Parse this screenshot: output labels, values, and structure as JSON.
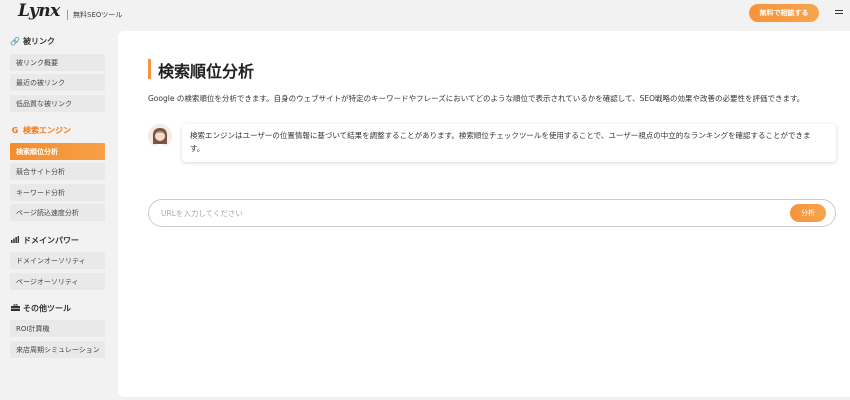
{
  "header": {
    "logo_text": "Lynx",
    "logo_sub": "無料SEOツール",
    "cta_label": "無料で相談する"
  },
  "sidebar": {
    "sections": [
      {
        "title": "被リンク",
        "icon": "link-icon",
        "items": [
          "被リンク概要",
          "最近の被リンク",
          "低品質な被リンク"
        ]
      },
      {
        "title": "検索エンジン",
        "icon": "google-icon",
        "items": [
          "検索順位分析",
          "競合サイト分析",
          "キーワード分析",
          "ページ読込速度分析"
        ]
      },
      {
        "title": "ドメインパワー",
        "icon": "bar-chart-icon",
        "items": [
          "ドメインオーソリティ",
          "ページオーソリティ"
        ]
      },
      {
        "title": "その他ツール",
        "icon": "toolbox-icon",
        "items": [
          "ROI計算機",
          "来店周期シミュレーション"
        ]
      }
    ],
    "active_item": "検索順位分析"
  },
  "main": {
    "title": "検索順位分析",
    "description": "Google の検索順位を分析できます。自身のウェブサイトが特定のキーワードやフレーズにおいてどのような順位で表示されているかを確認して、SEO戦略の効果や改善の必要性を評価できます。",
    "bubble_line1": "検索エンジンはユーザーの位置情報に基づいて結果を調整することがあります。検索順位チェックツールを使用することで、ユーザー視点の中立的なランキングを確認することができま",
    "bubble_line2": "す。",
    "search_placeholder": "URLを入力してください",
    "search_button": "分析"
  },
  "colors": {
    "accent": "#f7933a",
    "section_active": "#f07a1a"
  }
}
